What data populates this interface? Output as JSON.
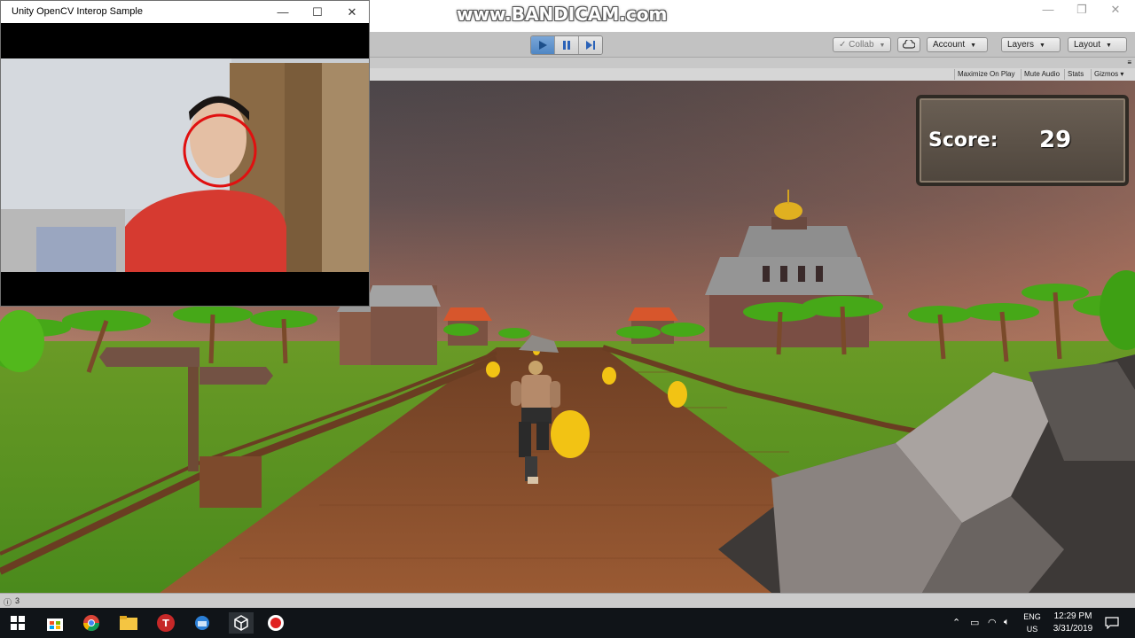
{
  "watermark": "www.BANDICAM.com",
  "opencv_window": {
    "title": "Unity OpenCV Interop Sample",
    "minimize_glyph": "—",
    "maximize_glyph": "☐",
    "close_glyph": "✕"
  },
  "toolbar": {
    "collab_label": "Collab",
    "account_label": "Account",
    "layers_label": "Layers",
    "layout_label": "Layout",
    "play_icon": "play-icon",
    "pause_icon": "pause-icon",
    "step_icon": "step-icon",
    "cloud_icon": "cloud-icon"
  },
  "game_view_options": {
    "maximize_on_play": "Maximize On Play",
    "mute_audio": "Mute Audio",
    "stats": "Stats",
    "gizmos": "Gizmos"
  },
  "hud": {
    "score_label": "Score:",
    "score_value": "29"
  },
  "status_bar": {
    "message_count": "3"
  },
  "taskbar": {
    "apps": [
      "windows-start-icon",
      "store-icon",
      "chrome-icon",
      "file-explorer-icon",
      "t-app-icon",
      "network-tool-icon",
      "unity-icon",
      "record-icon"
    ],
    "language_top": "ENG",
    "language_bottom": "US",
    "time": "12:29 PM",
    "date": "3/31/2019"
  },
  "colors": {
    "play_active": "#4f86c4",
    "face_circle": "#e01010",
    "taskbar_bg": "#101418"
  }
}
